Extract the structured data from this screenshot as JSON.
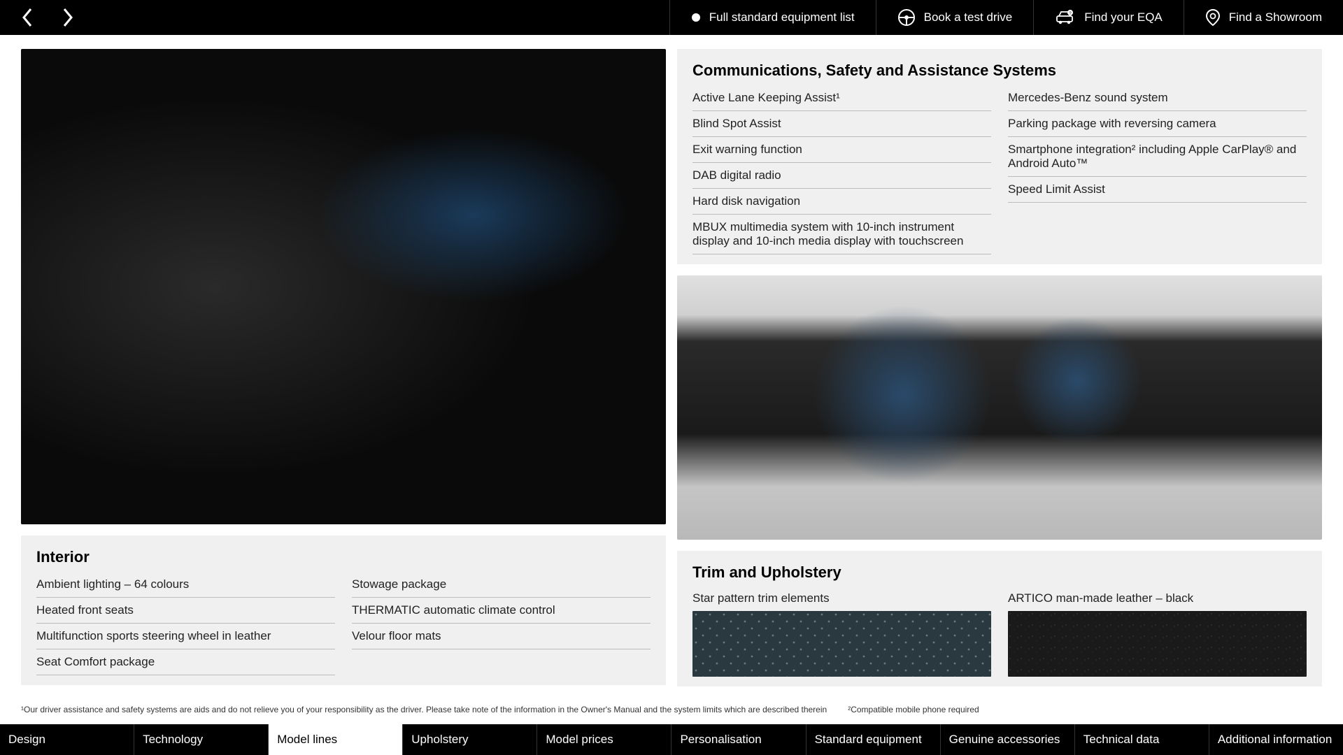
{
  "topnav": {
    "equipment_list": "Full standard equipment list",
    "test_drive": "Book a test drive",
    "find_eqa": "Find your EQA",
    "find_showroom": "Find a Showroom"
  },
  "sections": {
    "comms": {
      "title": "Communications, Safety and Assistance Systems",
      "left": [
        "Active Lane Keeping Assist¹",
        "Blind Spot Assist",
        "Exit warning function",
        "DAB digital radio",
        "Hard disk navigation",
        "MBUX multimedia system with 10-inch instrument display and 10-inch media display with touchscreen"
      ],
      "right": [
        "Mercedes-Benz sound system",
        "Parking package with reversing camera",
        "Smartphone integration² including Apple CarPlay® and Android Auto™",
        "Speed Limit Assist"
      ]
    },
    "interior": {
      "title": "Interior",
      "left": [
        "Ambient lighting – 64 colours",
        "Heated front seats",
        "Multifunction sports steering wheel in leather",
        "Seat Comfort package"
      ],
      "right": [
        "Stowage package",
        "THERMATIC automatic climate control",
        "Velour floor mats"
      ]
    },
    "trim": {
      "title": "Trim and Upholstery",
      "items": [
        "Star pattern trim elements",
        "ARTICO man-made leather – black"
      ]
    }
  },
  "footnotes": [
    "¹Our driver assistance and safety systems are aids and do not relieve you of your responsibility as the driver. Please take note of the information in the Owner's Manual and the system limits which are described therein",
    "²Compatible mobile phone required"
  ],
  "tabs": [
    "Design",
    "Technology",
    "Model lines",
    "Upholstery",
    "Model prices",
    "Personalisation",
    "Standard equipment",
    "Genuine accessories",
    "Technical data",
    "Additional information"
  ],
  "active_tab": 2
}
